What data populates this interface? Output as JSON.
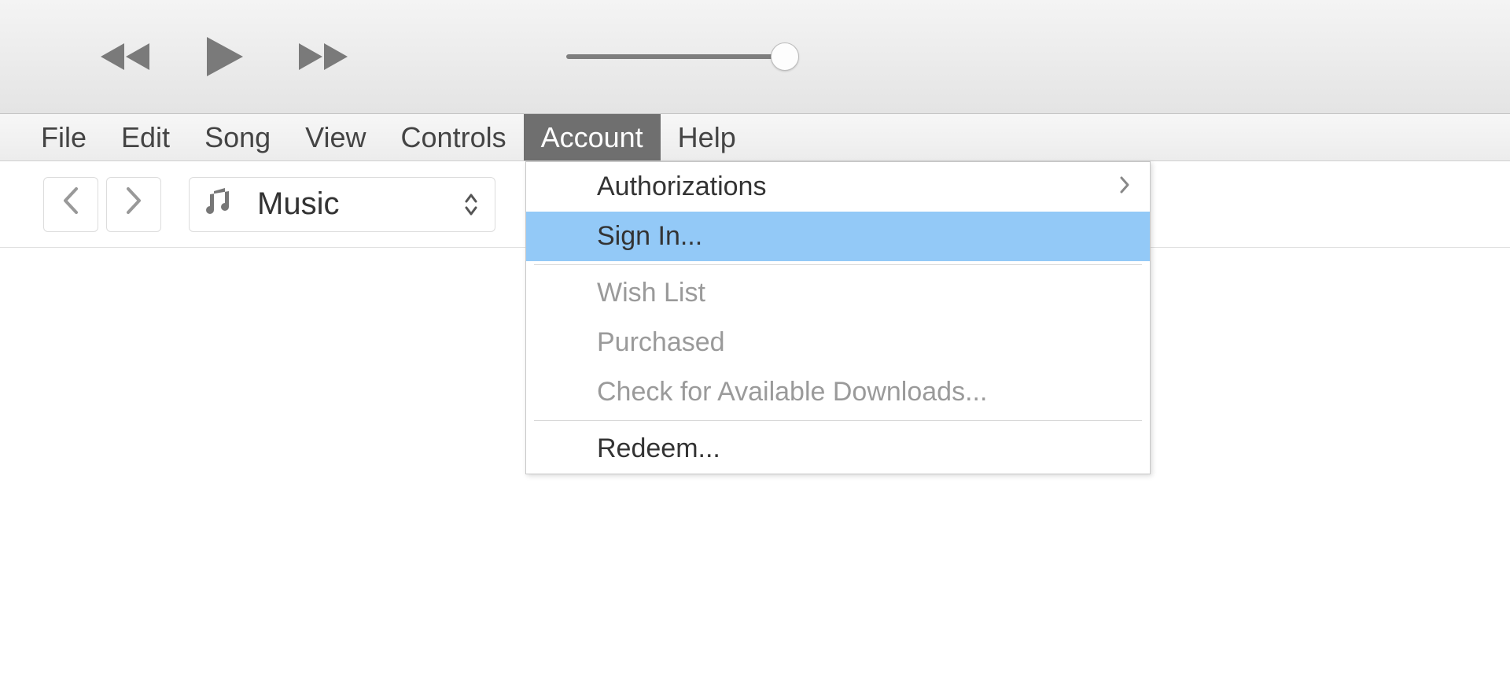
{
  "menubar": {
    "items": [
      {
        "label": "File"
      },
      {
        "label": "Edit"
      },
      {
        "label": "Song"
      },
      {
        "label": "View"
      },
      {
        "label": "Controls"
      },
      {
        "label": "Account"
      },
      {
        "label": "Help"
      }
    ],
    "active_index": 5
  },
  "library": {
    "selected": "Music"
  },
  "account_menu": {
    "items": [
      {
        "label": "Authorizations",
        "has_submenu": true,
        "disabled": false,
        "highlighted": false
      },
      {
        "label": "Sign In...",
        "has_submenu": false,
        "disabled": false,
        "highlighted": true
      },
      {
        "separator": true
      },
      {
        "label": "Wish List",
        "has_submenu": false,
        "disabled": true,
        "highlighted": false
      },
      {
        "label": "Purchased",
        "has_submenu": false,
        "disabled": true,
        "highlighted": false
      },
      {
        "label": "Check for Available Downloads...",
        "has_submenu": false,
        "disabled": true,
        "highlighted": false
      },
      {
        "separator": true
      },
      {
        "label": "Redeem...",
        "has_submenu": false,
        "disabled": false,
        "highlighted": false
      }
    ]
  }
}
